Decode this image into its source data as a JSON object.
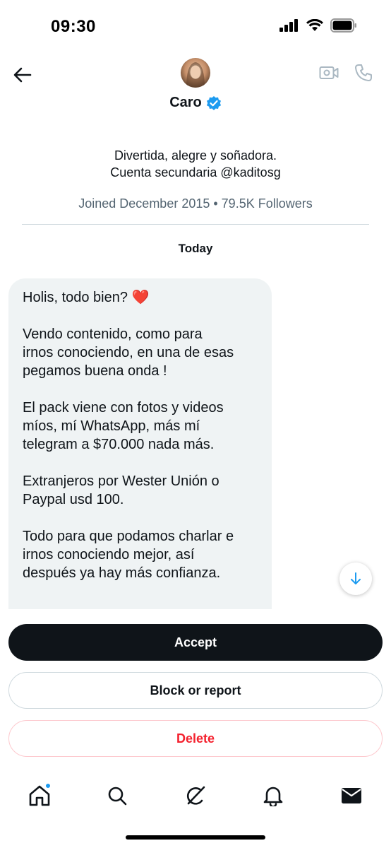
{
  "status_bar": {
    "time": "09:30"
  },
  "header": {
    "contact_name": "Caro",
    "icons": {
      "back": "arrow-left-icon",
      "video": "video-camera-icon",
      "call": "phone-icon",
      "verified": "verified-badge-icon"
    }
  },
  "profile": {
    "bio_line1": "Divertida, alegre y soñadora.",
    "bio_line2": "Cuenta secundaria @kaditosg",
    "meta": "Joined December 2015 • 79.5K Followers"
  },
  "conversation": {
    "date_label": "Today",
    "message_paragraphs": [
      "Holis, todo bien? ❤️",
      "Vendo contenido, como para\nirnos conociendo, en una de esas\npegamos buena onda !",
      "El pack viene con fotos y videos\nmíos, mí WhatsApp, más mí\ntelegram a $70.000 nada más.",
      "Extranjeros por Wester Unión o\nPaypal usd 100.",
      "Todo para que podamos charlar e\nirnos conociendo mejor, así\ndespués ya hay más confianza."
    ]
  },
  "actions": {
    "accept_label": "Accept",
    "block_label": "Block or report",
    "delete_label": "Delete"
  },
  "tabs": [
    "home-icon",
    "search-icon",
    "grok-icon",
    "bell-icon",
    "mail-icon"
  ],
  "colors": {
    "accent": "#1d9bf0",
    "danger": "#f4212e",
    "bubble": "#eff3f4",
    "muted": "#536471"
  }
}
